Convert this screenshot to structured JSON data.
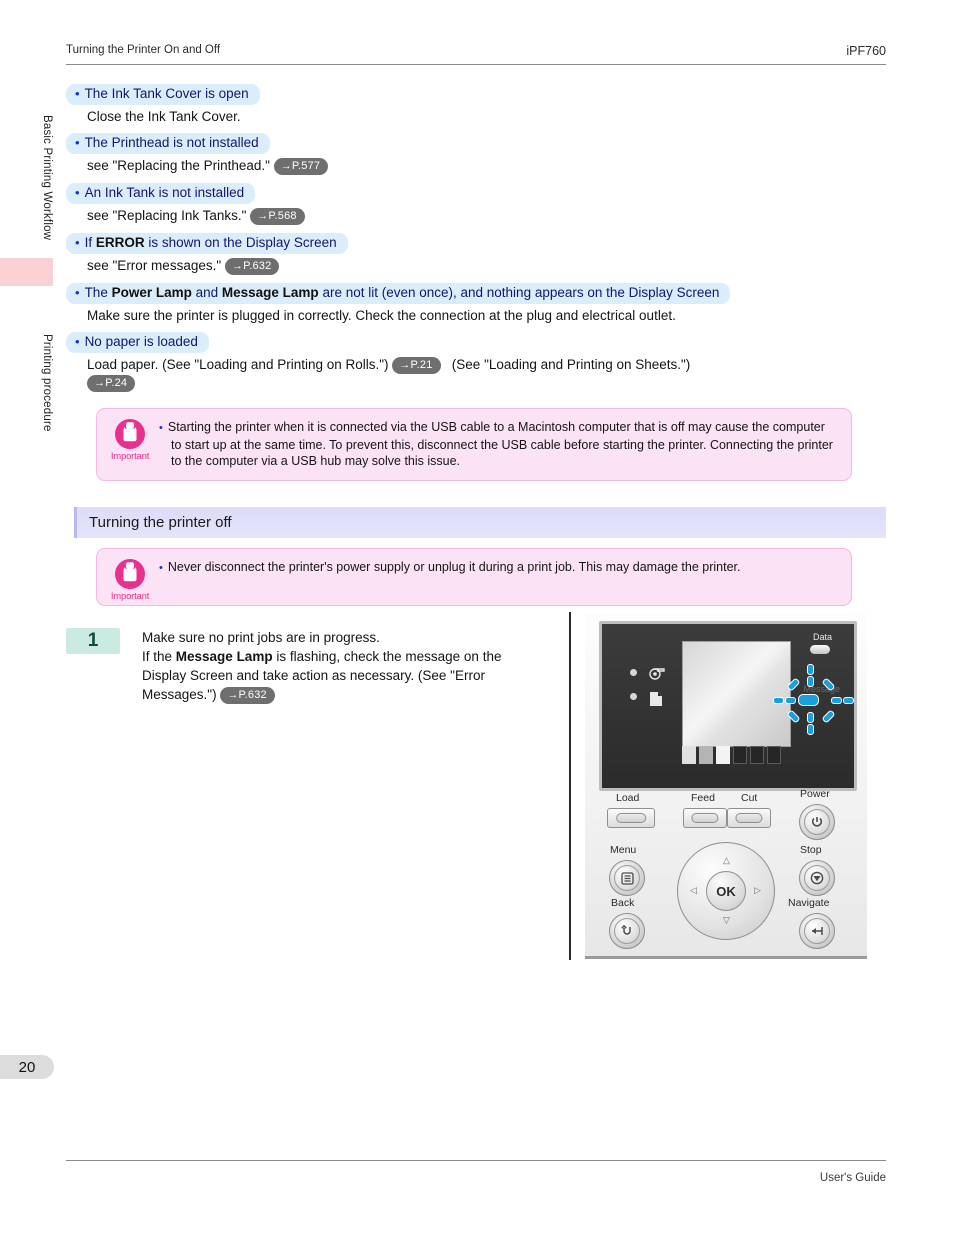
{
  "header": {
    "left_title": "Turning the Printer On and Off",
    "right_model": "iPF760"
  },
  "footer": {
    "right_text": "User's Guide"
  },
  "sidebar": {
    "tabs": [
      {
        "label": "Basic Printing Workflow"
      },
      {
        "label": "Printing procedure"
      }
    ],
    "page_number": "20"
  },
  "causes": [
    {
      "head_prefix": "The Ink Tank Cover is open",
      "head_bold": "",
      "head_suffix": "",
      "body": "Close the Ink Tank Cover.",
      "ref": ""
    },
    {
      "head_prefix": "The Printhead is not installed",
      "head_bold": "",
      "head_suffix": "",
      "body": "see \"Replacing the Printhead.\"",
      "ref": "→P.577"
    },
    {
      "head_prefix": "An Ink Tank is not installed",
      "head_bold": "",
      "head_suffix": "",
      "body": "see \"Replacing Ink Tanks.\"",
      "ref": "→P.568"
    },
    {
      "head_prefix": "If ",
      "head_bold": "ERROR",
      "head_suffix": " is shown on the Display Screen",
      "body": "see \"Error messages.\"",
      "ref": "→P.632"
    },
    {
      "head_prefix": "The ",
      "head_bold": "Power Lamp",
      "head_mid": " and ",
      "head_bold2": "Message Lamp",
      "head_suffix": " are not lit (even once), and nothing appears on the Display Screen",
      "body": "Make sure the printer is plugged in correctly. Check the connection at the plug and electrical outlet.",
      "ref": ""
    },
    {
      "head_prefix": "No paper is loaded",
      "head_bold": "",
      "head_suffix": "",
      "body_a": "Load paper.  (See \"Loading and Printing on Rolls.\")",
      "ref_a": "→P.21",
      "body_b": "(See \"Loading and Printing on Sheets.\")",
      "ref_b": "→P.24"
    }
  ],
  "important_usb": {
    "label": "Important",
    "text": "Starting the printer when it is connected via the USB cable to a Macintosh computer that is off may cause the computer to start up at the same time. To prevent this, disconnect the USB cable before starting the printer. Connecting the printer to the computer via a USB hub may solve this issue."
  },
  "section": {
    "heading": "Turning the printer off"
  },
  "important_power": {
    "label": "Important",
    "text": "Never disconnect the printer's power supply or unplug it during a print job. This may damage the printer."
  },
  "step": {
    "number": "1",
    "line1": "Make sure no print jobs are in progress.",
    "line2_a": "If the ",
    "line2_bold": "Message Lamp",
    "line2_b": " is flashing, check the message on the",
    "line3": "Display Screen and take action as necessary.  (See \"Error",
    "line4": "Messages.\")",
    "ref": "→P.632"
  },
  "printer_panel": {
    "data_label": "Data",
    "message_label": "Message",
    "buttons": {
      "load": "Load",
      "feed": "Feed",
      "cut": "Cut",
      "power": "Power",
      "menu": "Menu",
      "back": "Back",
      "stop": "Stop",
      "navigate": "Navigate",
      "ok": "OK"
    }
  },
  "colors": {
    "highlight_blue": "#d9edfb",
    "important_pink": "#fbe2f4",
    "accent_magenta": "#e8308f",
    "section_purple": "#dcdcfa",
    "step_teal": "#cbeae2",
    "lamp_blue": "#17a0dd"
  }
}
